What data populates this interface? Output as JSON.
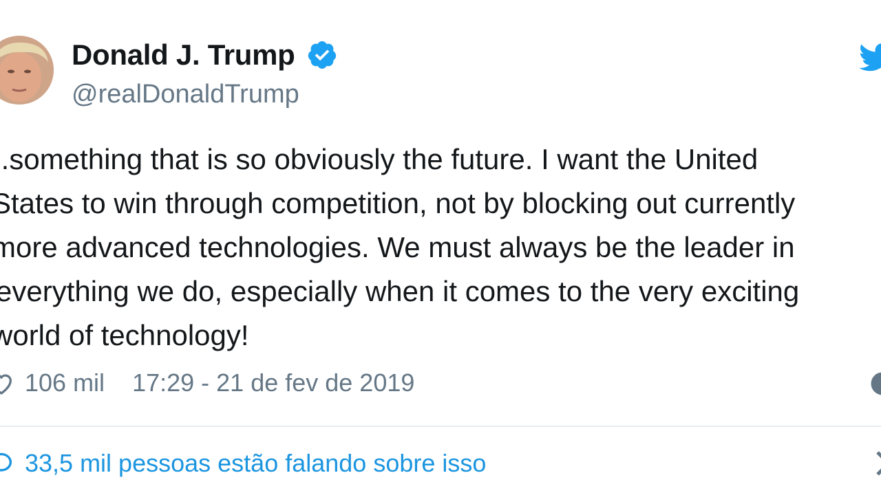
{
  "tweet": {
    "author": {
      "display_name": "Donald J. Trump",
      "handle": "@realDonaldTrump",
      "verified": true
    },
    "text_lines": [
      "..something that is so obviously the future. I want the United",
      "States to win through competition, not by blocking out currently",
      "more advanced technologies. We must always be the leader in",
      "everything we do, especially when it comes to the very exciting",
      "world of technology!"
    ],
    "likes": "106 mil",
    "timestamp": "17:29 - 21 de fev de 2019",
    "conversation": "33,5 mil pessoas estão falando sobre isso"
  },
  "icons": {
    "verified": "verified-badge-icon",
    "brand": "twitter-bird-icon",
    "like": "heart-icon",
    "info": "info-icon",
    "reply": "speech-bubble-icon",
    "more": "chevron-right-icon"
  },
  "colors": {
    "brand": "#1da1f2",
    "secondary_text": "#657786",
    "link": "#1b95e0",
    "primary_text": "#14171a"
  }
}
